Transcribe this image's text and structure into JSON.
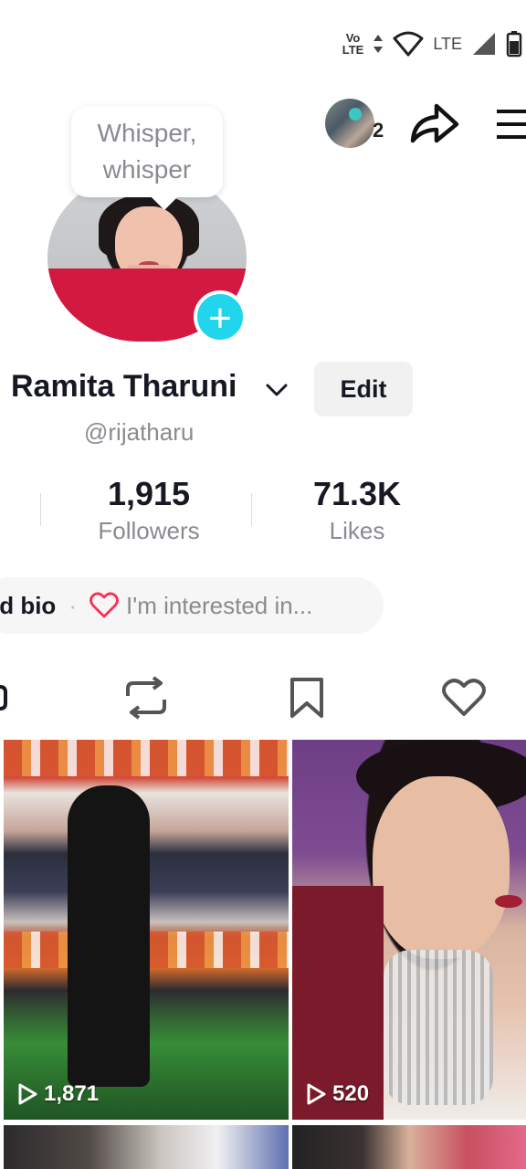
{
  "status_bar": {
    "volte_top": "Vo",
    "volte_bottom": "LTE",
    "network": "LTE"
  },
  "header": {
    "friend_count": "2",
    "share_icon": "share-arrow-icon",
    "menu_icon": "hamburger-menu-icon"
  },
  "profile": {
    "bubble_text": "Whisper,\nwhisper",
    "name": "Ramita Tharuni",
    "edit_label": "Edit",
    "handle": "@rijatharu"
  },
  "stats": [
    {
      "value": "1,915",
      "label": "Followers"
    },
    {
      "value": "71.3K",
      "label": "Likes"
    }
  ],
  "bio": {
    "add_bio": "ld bio",
    "separator": "·",
    "interested": "I'm interested in..."
  },
  "tabs": [
    "grid-icon",
    "repost-icon",
    "bookmark-icon",
    "heart-icon"
  ],
  "videos": [
    {
      "views": "1,871"
    },
    {
      "views": "520"
    }
  ],
  "colors": {
    "accent": "#20d5ec",
    "heart": "#fe2c55",
    "text_primary": "#161823",
    "text_secondary": "#8a8b91"
  }
}
